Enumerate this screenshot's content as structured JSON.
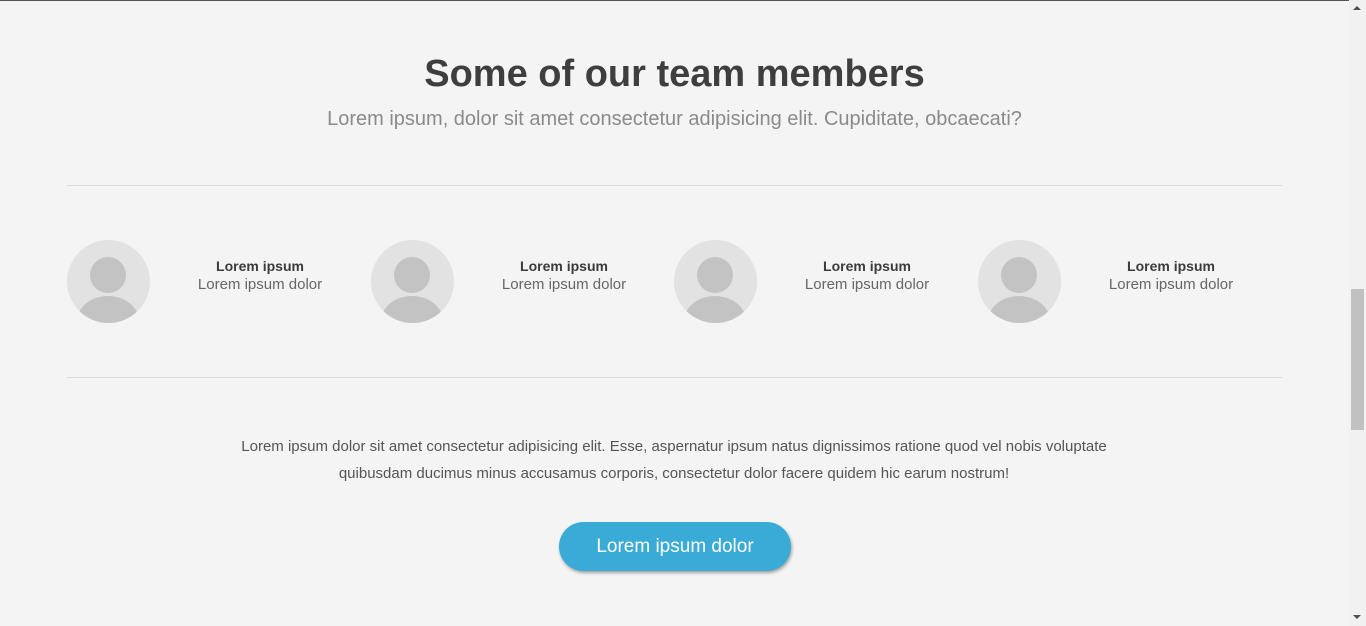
{
  "section": {
    "title": "Some of our team members",
    "subtitle": "Lorem ipsum, dolor sit amet consectetur adipisicing elit. Cupiditate, obcaecati?"
  },
  "members": [
    {
      "name": "Lorem ipsum",
      "role": "Lorem ipsum dolor",
      "avatar_icon": "user-avatar-icon"
    },
    {
      "name": "Lorem ipsum",
      "role": "Lorem ipsum dolor",
      "avatar_icon": "user-avatar-icon"
    },
    {
      "name": "Lorem ipsum",
      "role": "Lorem ipsum dolor",
      "avatar_icon": "user-avatar-icon"
    },
    {
      "name": "Lorem ipsum",
      "role": "Lorem ipsum dolor",
      "avatar_icon": "user-avatar-icon"
    }
  ],
  "description": "Lorem ipsum dolor sit amet consectetur adipisicing elit. Esse, aspernatur ipsum natus dignissimos ratione quod vel nobis voluptate quibusdam ducimus minus accusamus corporis, consectetur dolor facere quidem hic earum nostrum!",
  "cta": {
    "label": "Lorem ipsum dolor"
  },
  "colors": {
    "background": "#f4f4f4",
    "accent": "#3aabd6",
    "heading": "#3e3e3e"
  }
}
